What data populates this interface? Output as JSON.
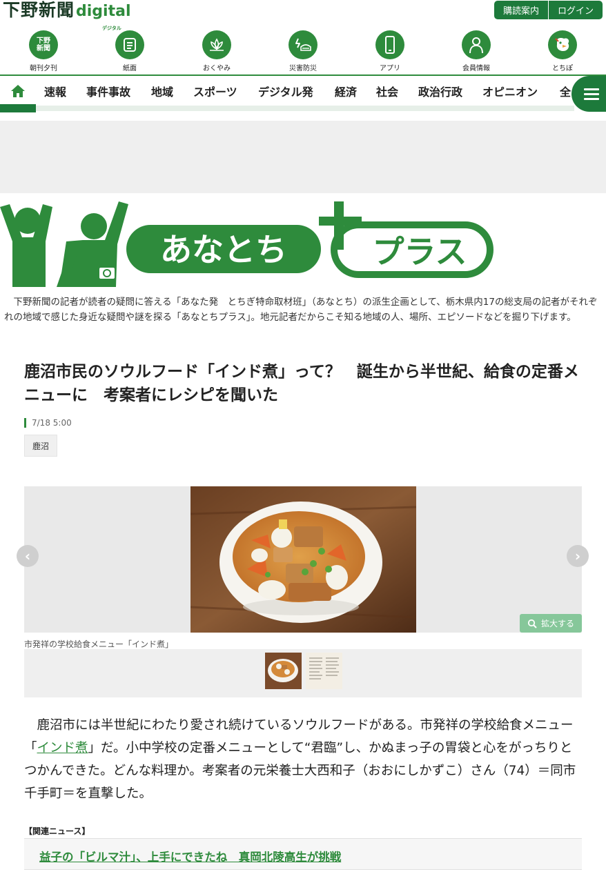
{
  "header": {
    "logo_main": "下野新聞",
    "logo_digital": "digital",
    "logo_digital_sub": "デジタル",
    "subscribe_label": "購読案内",
    "login_label": "ログイン"
  },
  "icon_nav": [
    {
      "label": "朝刊夕刊",
      "icon": "newspaper-logo-icon",
      "icon_text": "下野\n新聞"
    },
    {
      "label": "紙面",
      "icon": "document-icon"
    },
    {
      "label": "おくやみ",
      "icon": "lotus-icon"
    },
    {
      "label": "災害防災",
      "icon": "disaster-icon"
    },
    {
      "label": "アプリ",
      "icon": "smartphone-icon"
    },
    {
      "label": "会員情報",
      "icon": "member-icon"
    },
    {
      "label": "とちぽ",
      "icon": "mascot-icon"
    }
  ],
  "category_nav": [
    "速報",
    "事件事故",
    "地域",
    "スポーツ",
    "デジタル発",
    "経済",
    "社会",
    "政治行政",
    "オピニオン",
    "全"
  ],
  "banner": {
    "title": "あなとち",
    "plus": "プラス"
  },
  "intro_text": "下野新聞の記者が読者の疑問に答える「あなた発　とちぎ特命取材班」（あなとち）の派生企画として、栃木県内17の総支局の記者がそれぞれの地域で感じた身近な疑問や謎を探る「あなとちプラス」。地元記者だからこそ知る地域の人、場所、エピソードなどを掘り下げます。",
  "article": {
    "title": "鹿沼市民のソウルフード「インド煮」って？　誕生から半世紀、給食の定番メニューに　考案者にレシピを聞いた",
    "date": "7/18 5:00",
    "tag": "鹿沼",
    "zoom_label": "拡大する",
    "photo_caption": "市発祥の学校給食メニュー「インド煮」",
    "body_before_link": "鹿沼市には半世紀にわたり愛され続けているソウルフードがある。市発祥の学校給食メニュー「",
    "body_link": "インド煮",
    "body_after_link": "」だ。小中学校の定番メニューとして“君臨”し、かぬまっ子の胃袋と心をがっちりとつかんできた。どんな料理か。考案者の元栄養士大西和子（おおにしかずこ）さん（74）＝同市千手町＝を直撃した。"
  },
  "related": {
    "heading": "【関連ニュース】",
    "link_text": "益子の「ビルマ汁」、上手にできたね　真岡北陵高生が挑戦"
  },
  "colors": {
    "brand_green": "#2e8b3c",
    "dark_green": "#1d7a3b",
    "light_green": "#86c79a"
  }
}
